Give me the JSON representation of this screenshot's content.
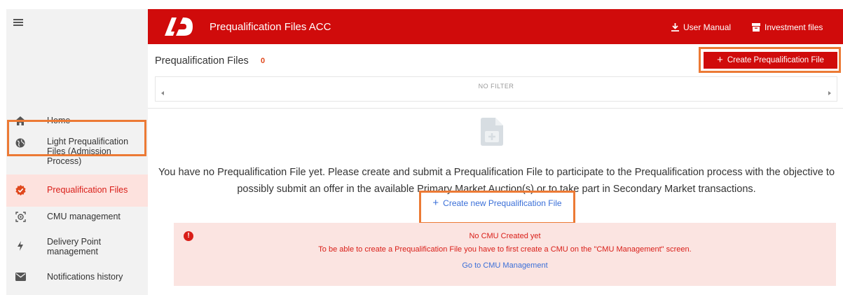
{
  "colors": {
    "brand": "#d00b0b",
    "highlight": "#ec7a35",
    "link": "#3a6fd8",
    "alert_bg": "#fbe4e1"
  },
  "topbar": {
    "title": "Prequalification Files ACC",
    "user_manual": "User Manual",
    "investment_files": "Investment files"
  },
  "sidebar": {
    "items": [
      {
        "label": "Home",
        "icon": "home-icon"
      },
      {
        "label": "Light Prequalification Files (Admission Process)",
        "icon": "globe-icon"
      },
      {
        "label": "Prequalification Files",
        "icon": "badge-check-icon",
        "active": true
      },
      {
        "label": "CMU management",
        "icon": "target-icon"
      },
      {
        "label": "Delivery Point management",
        "icon": "bolt-icon"
      },
      {
        "label": "Notifications history",
        "icon": "mail-icon"
      }
    ]
  },
  "header": {
    "title": "Prequalification Files",
    "count": "0",
    "create_button": "Create Prequalification File"
  },
  "filter": {
    "text": "NO FILTER"
  },
  "empty": {
    "message": "You have no Prequalification File yet. Please create and submit a Prequalification File to participate to the Prequalification process with the objective to possibly submit an offer in the available Primary Market Auction(s) or to take part in Secondary Market transactions.",
    "create_link": "Create new Prequalification File"
  },
  "alert": {
    "title": "No CMU Created yet",
    "text": "To be able to create a Prequalification File you have to first create a CMU on the \"CMU Management\" screen.",
    "link": "Go to CMU Management"
  }
}
